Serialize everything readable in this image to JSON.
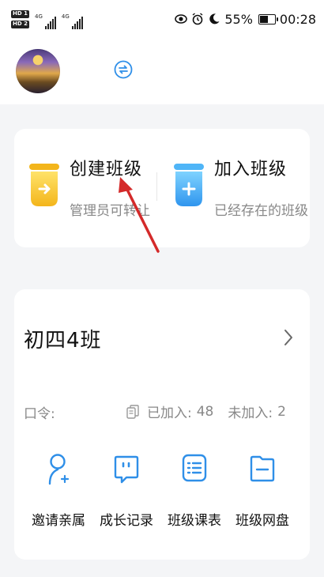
{
  "status_bar": {
    "hd1": "HD 1",
    "hd2": "HD 2",
    "net1": "4G",
    "net2": "4G",
    "battery_percent": "55%",
    "battery_level": 0.55,
    "time": "00:28"
  },
  "actions": [
    {
      "title": "创建班级",
      "subtitle": "管理员可转让",
      "icon": "yellow-bookmark-arrow-icon",
      "color": "#f6c72f"
    },
    {
      "title": "加入班级",
      "subtitle": "已经存在的班级",
      "icon": "blue-bookmark-plus-icon",
      "color": "#39a7f2"
    }
  ],
  "class_card": {
    "name": "初四4班",
    "code_label": "口令:",
    "joined_label": "已加入:",
    "joined_count": "48",
    "not_joined_label": "未加入:",
    "not_joined_count": "2",
    "tools": [
      {
        "label": "邀请亲属",
        "icon": "invite-person-icon"
      },
      {
        "label": "成长记录",
        "icon": "growth-record-icon"
      },
      {
        "label": "班级课表",
        "icon": "timetable-icon"
      },
      {
        "label": "班级网盘",
        "icon": "cloud-drive-folder-icon"
      }
    ]
  },
  "colors": {
    "accent_blue": "#2f8fe8",
    "yellow": "#f6c72f",
    "annotation_red": "#d42a2a"
  }
}
